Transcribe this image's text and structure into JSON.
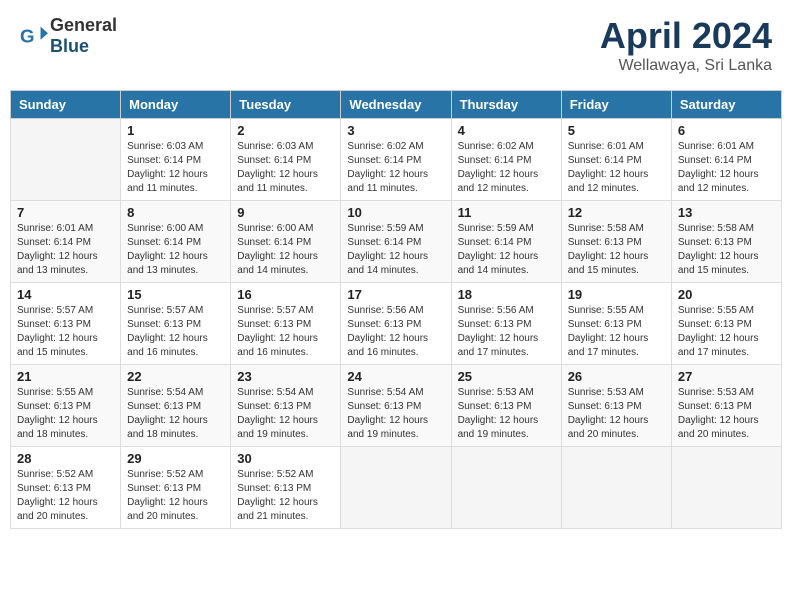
{
  "header": {
    "logo_general": "General",
    "logo_blue": "Blue",
    "month_year": "April 2024",
    "location": "Wellawaya, Sri Lanka"
  },
  "days_of_week": [
    "Sunday",
    "Monday",
    "Tuesday",
    "Wednesday",
    "Thursday",
    "Friday",
    "Saturday"
  ],
  "weeks": [
    [
      {
        "day": "",
        "info": ""
      },
      {
        "day": "1",
        "info": "Sunrise: 6:03 AM\nSunset: 6:14 PM\nDaylight: 12 hours\nand 11 minutes."
      },
      {
        "day": "2",
        "info": "Sunrise: 6:03 AM\nSunset: 6:14 PM\nDaylight: 12 hours\nand 11 minutes."
      },
      {
        "day": "3",
        "info": "Sunrise: 6:02 AM\nSunset: 6:14 PM\nDaylight: 12 hours\nand 11 minutes."
      },
      {
        "day": "4",
        "info": "Sunrise: 6:02 AM\nSunset: 6:14 PM\nDaylight: 12 hours\nand 12 minutes."
      },
      {
        "day": "5",
        "info": "Sunrise: 6:01 AM\nSunset: 6:14 PM\nDaylight: 12 hours\nand 12 minutes."
      },
      {
        "day": "6",
        "info": "Sunrise: 6:01 AM\nSunset: 6:14 PM\nDaylight: 12 hours\nand 12 minutes."
      }
    ],
    [
      {
        "day": "7",
        "info": ""
      },
      {
        "day": "8",
        "info": "Sunrise: 6:00 AM\nSunset: 6:14 PM\nDaylight: 12 hours\nand 13 minutes."
      },
      {
        "day": "9",
        "info": "Sunrise: 6:00 AM\nSunset: 6:14 PM\nDaylight: 12 hours\nand 14 minutes."
      },
      {
        "day": "10",
        "info": "Sunrise: 5:59 AM\nSunset: 6:14 PM\nDaylight: 12 hours\nand 14 minutes."
      },
      {
        "day": "11",
        "info": "Sunrise: 5:59 AM\nSunset: 6:14 PM\nDaylight: 12 hours\nand 14 minutes."
      },
      {
        "day": "12",
        "info": "Sunrise: 5:58 AM\nSunset: 6:13 PM\nDaylight: 12 hours\nand 15 minutes."
      },
      {
        "day": "13",
        "info": "Sunrise: 5:58 AM\nSunset: 6:13 PM\nDaylight: 12 hours\nand 15 minutes."
      }
    ],
    [
      {
        "day": "14",
        "info": ""
      },
      {
        "day": "15",
        "info": "Sunrise: 5:57 AM\nSunset: 6:13 PM\nDaylight: 12 hours\nand 16 minutes."
      },
      {
        "day": "16",
        "info": "Sunrise: 5:57 AM\nSunset: 6:13 PM\nDaylight: 12 hours\nand 16 minutes."
      },
      {
        "day": "17",
        "info": "Sunrise: 5:56 AM\nSunset: 6:13 PM\nDaylight: 12 hours\nand 16 minutes."
      },
      {
        "day": "18",
        "info": "Sunrise: 5:56 AM\nSunset: 6:13 PM\nDaylight: 12 hours\nand 17 minutes."
      },
      {
        "day": "19",
        "info": "Sunrise: 5:55 AM\nSunset: 6:13 PM\nDaylight: 12 hours\nand 17 minutes."
      },
      {
        "day": "20",
        "info": "Sunrise: 5:55 AM\nSunset: 6:13 PM\nDaylight: 12 hours\nand 17 minutes."
      }
    ],
    [
      {
        "day": "21",
        "info": ""
      },
      {
        "day": "22",
        "info": "Sunrise: 5:54 AM\nSunset: 6:13 PM\nDaylight: 12 hours\nand 18 minutes."
      },
      {
        "day": "23",
        "info": "Sunrise: 5:54 AM\nSunset: 6:13 PM\nDaylight: 12 hours\nand 19 minutes."
      },
      {
        "day": "24",
        "info": "Sunrise: 5:54 AM\nSunset: 6:13 PM\nDaylight: 12 hours\nand 19 minutes."
      },
      {
        "day": "25",
        "info": "Sunrise: 5:53 AM\nSunset: 6:13 PM\nDaylight: 12 hours\nand 19 minutes."
      },
      {
        "day": "26",
        "info": "Sunrise: 5:53 AM\nSunset: 6:13 PM\nDaylight: 12 hours\nand 20 minutes."
      },
      {
        "day": "27",
        "info": "Sunrise: 5:53 AM\nSunset: 6:13 PM\nDaylight: 12 hours\nand 20 minutes."
      }
    ],
    [
      {
        "day": "28",
        "info": "Sunrise: 5:52 AM\nSunset: 6:13 PM\nDaylight: 12 hours\nand 20 minutes."
      },
      {
        "day": "29",
        "info": "Sunrise: 5:52 AM\nSunset: 6:13 PM\nDaylight: 12 hours\nand 20 minutes."
      },
      {
        "day": "30",
        "info": "Sunrise: 5:52 AM\nSunset: 6:13 PM\nDaylight: 12 hours\nand 21 minutes."
      },
      {
        "day": "",
        "info": ""
      },
      {
        "day": "",
        "info": ""
      },
      {
        "day": "",
        "info": ""
      },
      {
        "day": "",
        "info": ""
      }
    ]
  ],
  "week1_sun_info": "Sunrise: 6:01 AM\nSunset: 6:14 PM\nDaylight: 12 hours\nand 13 minutes.",
  "week3_sun_info": "Sunrise: 5:57 AM\nSunset: 6:13 PM\nDaylight: 12 hours\nand 15 minutes.",
  "week4_sun_info": "Sunrise: 5:55 AM\nSunset: 6:13 PM\nDaylight: 12 hours\nand 18 minutes."
}
